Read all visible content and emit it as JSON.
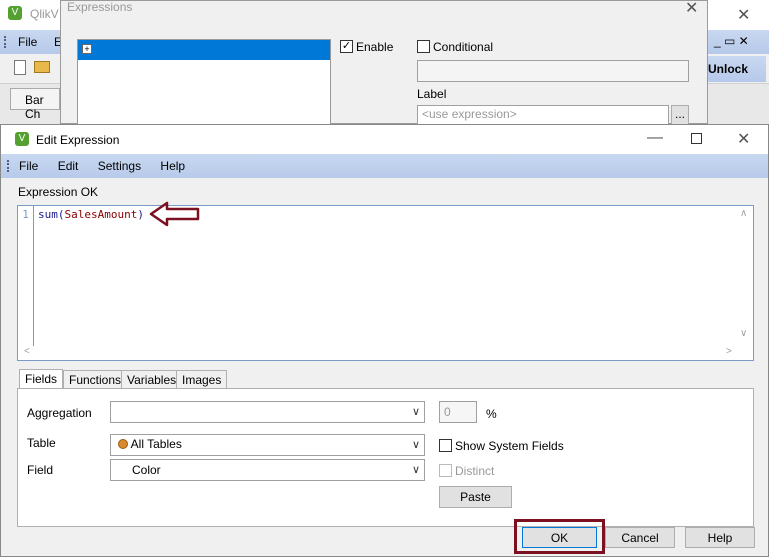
{
  "background_window": {
    "title": "QlikV",
    "menu_file": "File",
    "menu_edit_partial": "E",
    "unlock_label": "Unlock",
    "tab_label": "Bar Ch"
  },
  "expressions_dialog": {
    "title": "Expressions",
    "enable_label": "Enable",
    "enable_checked": true,
    "conditional_label": "Conditional",
    "label_caption": "Label",
    "label_placeholder": "<use expression>",
    "browse_label": "..."
  },
  "edit_expression": {
    "title": "Edit Expression",
    "menu": [
      "File",
      "Edit",
      "Settings",
      "Help"
    ],
    "status": "Expression OK",
    "line_number": "1",
    "code_func": "sum(",
    "code_arg": "SalesAmount",
    "code_close": ")",
    "tabs": [
      "Fields",
      "Functions",
      "Variables",
      "Images"
    ],
    "aggregation_label": "Aggregation",
    "aggregation_value": "",
    "percent_value": "0",
    "percent_sign": "%",
    "table_label": "Table",
    "table_value": "All Tables",
    "show_system_fields_label": "Show System Fields",
    "field_label": "Field",
    "field_value": "Color",
    "distinct_label": "Distinct",
    "paste_label": "Paste",
    "ok_label": "OK",
    "cancel_label": "Cancel",
    "help_label": "Help"
  },
  "colors": {
    "annotation": "#7b1020",
    "accent": "#0078d7",
    "menu_bar": "#c9d8f0"
  }
}
